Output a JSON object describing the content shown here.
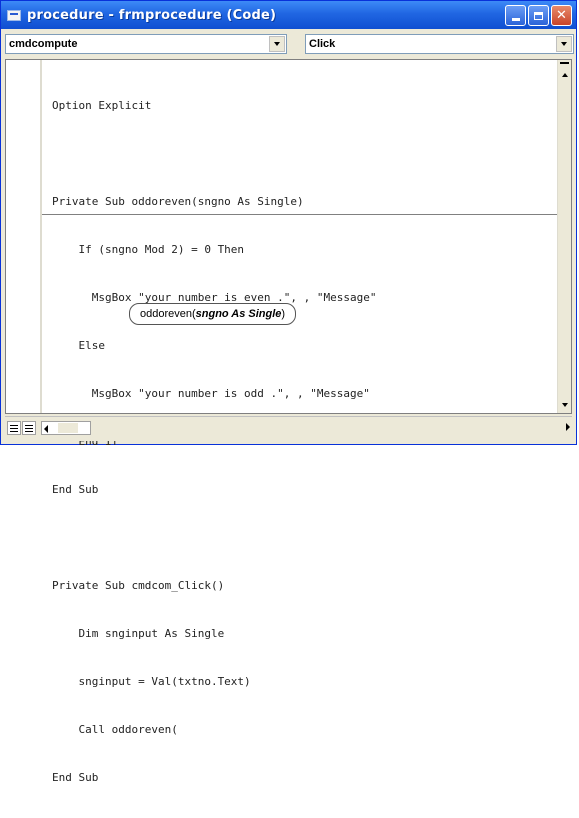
{
  "window": {
    "title": "procedure - frmprocedure (Code)"
  },
  "combos": {
    "object": "cmdcompute",
    "procedure": "Click"
  },
  "code": {
    "lines": [
      "Option Explicit",
      "",
      "Private Sub oddoreven(sngno As Single)",
      "    If (sngno Mod 2) = 0 Then",
      "      MsgBox \"your number is even .\", , \"Message\"",
      "    Else",
      "      MsgBox \"your number is odd .\", , \"Message\"",
      "    End If",
      "End Sub",
      "",
      "Private Sub cmdcom_Click()",
      "    Dim snginput As Single",
      "    snginput = Val(txtno.Text)",
      "    Call oddoreven(",
      "End Sub"
    ]
  },
  "tooltip": {
    "prefix": "oddoreven(",
    "param": "sngno As Single",
    "suffix": ")"
  }
}
